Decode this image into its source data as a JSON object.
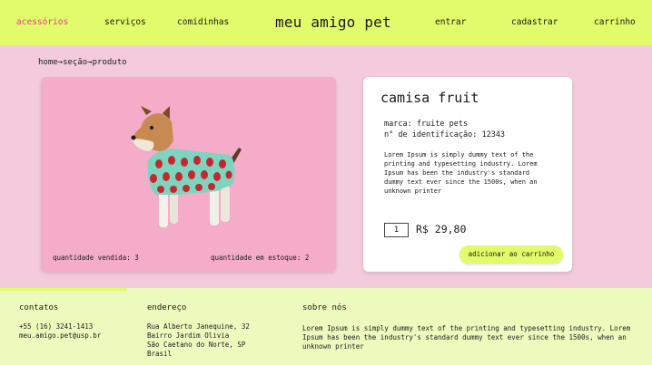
{
  "nav": {
    "items_left": [
      "acessórios",
      "serviços",
      "comidinhas"
    ],
    "brand": "meu amigo pet",
    "items_right": [
      "entrar",
      "cadastrar",
      "carrinho"
    ],
    "active_color": "#e0428e",
    "bg_color": "#e2fb6a"
  },
  "breadcrumb": "home→seção→produto",
  "product_card": {
    "image": "dog-in-strawberry-shirt",
    "qty_sold_label": "quantidade vendida: 3",
    "qty_stock_label": "quantidade em estoque: 2"
  },
  "product": {
    "title": "camisa fruit",
    "brand_line": "marca: fruite pets",
    "id_line": "n° de identificação: 12343",
    "description": "Lorem Ipsum is simply dummy text of the printing and typesetting industry. Lorem Ipsum has been the industry's standard dummy text ever since the 1500s, when an unknown printer",
    "quantity": "1",
    "price": "R$ 29,80",
    "cart_button": "adicionar ao carrinho"
  },
  "footer": {
    "contacts": {
      "title": "contatos",
      "lines": [
        "+55 (16) 3241-1413",
        "meu.amigo.pet@usp.br"
      ]
    },
    "address": {
      "title": "endereço",
      "lines": [
        "Rua Alberto Janequine, 32",
        "Bairro Jardim Olivia",
        "São Caetano do Norte, SP",
        "Brasil"
      ]
    },
    "about": {
      "title": "sobre nós",
      "text": "Lorem Ipsum is simply dummy text of the printing and typesetting industry. Lorem Ipsum has been the industry's standard dummy text ever since the 1500s, when an unknown printer"
    },
    "bg_color": "#ecfbbd"
  },
  "colors": {
    "page_bg": "#f4cbdc",
    "image_card_bg": "#f4acc8",
    "accent": "#e2fb6a"
  }
}
